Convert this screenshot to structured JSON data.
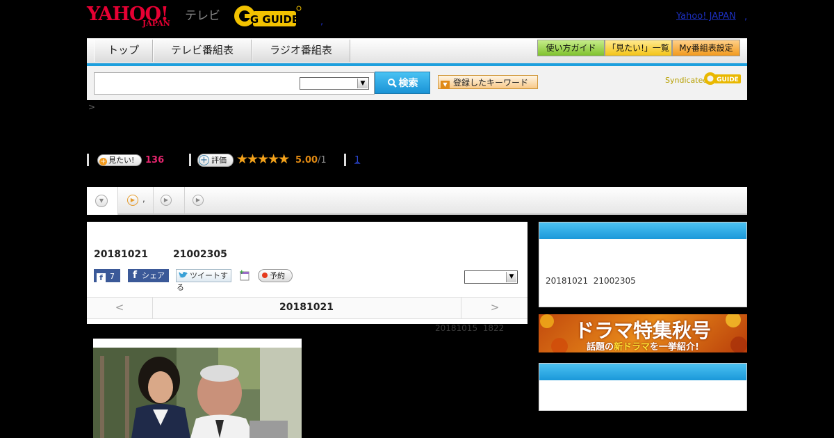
{
  "header": {
    "logo_main": "YAHOO!",
    "logo_sub": "JAPAN",
    "logo_tv": "テレビ",
    "gguide_logo": "G GUIDE",
    "yahoo_japan_link": "Yahoo! JAPAN",
    "link_separator": ",",
    "dot": ","
  },
  "nav": {
    "tabs": [
      {
        "label": "トップ"
      },
      {
        "label": "テレビ番組表"
      },
      {
        "label": "ラジオ番組表"
      }
    ],
    "buttons": [
      {
        "label": "使い方ガイド"
      },
      {
        "label": "「見たい!」一覧"
      },
      {
        "label": "My番組表設定"
      }
    ]
  },
  "search": {
    "button_label": "検索",
    "keyword_button_label": "登録したキーワード",
    "syndicated_label": "Syndicated",
    "syndicated_logo": "GUIDE"
  },
  "breadcrumb": {
    "gt": ">"
  },
  "stats": {
    "mitai_label": "見たい!",
    "mitai_count": "136",
    "hyoka_label": "評価",
    "stars": "★★★★★",
    "rating": "5.00",
    "rating_denominator": "/1",
    "link_count": "1"
  },
  "tabs": [
    {
      "label": ""
    },
    {
      "label": ","
    },
    {
      "label": ""
    },
    {
      "label": ""
    }
  ],
  "program": {
    "date": "20181021",
    "time": "21002305",
    "fb_count": "7",
    "fb_share_label": "シェア",
    "tweet_label": "ツイートする",
    "reserve_label": "予約",
    "prev_symbol": "<",
    "next_symbol": ">",
    "nav_date": "20181021",
    "updated_date": "20181015",
    "updated_time": "1822"
  },
  "sidebar": {
    "box1_date": "20181021",
    "box1_time": "21002305",
    "banner_title": "ドラマ特集秋号",
    "banner_subtitle_pre": "話題の",
    "banner_subtitle_em": "新ドラマ",
    "banner_subtitle_post": "を一挙紹介!"
  },
  "colors": {
    "accent_blue": "#1d9fdd",
    "brand_red": "#e60033",
    "count_pink": "#e5256d",
    "star_orange": "#f3a21b",
    "gguide_yellow": "#f2c200"
  }
}
